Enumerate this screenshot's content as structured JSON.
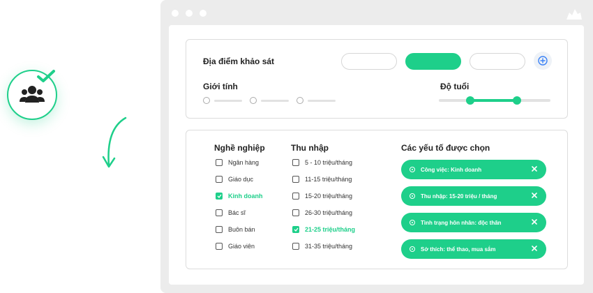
{
  "survey": {
    "location_label": "Địa điểm khảo sát",
    "gender_label": "Giới tính",
    "age_label": "Độ tuổi",
    "age_range": [
      0.28,
      0.7
    ]
  },
  "occupation": {
    "title": "Nghề nghiệp",
    "items": [
      {
        "label": "Ngân hàng",
        "checked": false
      },
      {
        "label": "Giáo dục",
        "checked": false
      },
      {
        "label": "Kinh doanh",
        "checked": true
      },
      {
        "label": "Bác sĩ",
        "checked": false
      },
      {
        "label": "Buôn bán",
        "checked": false
      },
      {
        "label": "Giáo viên",
        "checked": false
      }
    ]
  },
  "income": {
    "title": "Thu nhập",
    "items": [
      {
        "label": "5 - 10 triệu/tháng",
        "checked": false
      },
      {
        "label": "11-15 triệu/tháng",
        "checked": false
      },
      {
        "label": "15-20 triệu/tháng",
        "checked": false
      },
      {
        "label": "26-30 triệu/tháng",
        "checked": false
      },
      {
        "label": "21-25 triệu/tháng",
        "checked": true
      },
      {
        "label": "31-35 triệu/tháng",
        "checked": false
      }
    ]
  },
  "selected": {
    "title": "Các yếu tố được chọn",
    "tags": [
      "Công việc: Kinh doanh",
      "Thu nhập: 15-20 triệu / tháng",
      "Tình trạng hôn nhân: độc thân",
      "Sở thích: thể thao, mua sắm"
    ]
  },
  "colors": {
    "accent": "#1ecf8a",
    "window": "#ececec",
    "border": "#dcdcdc"
  },
  "icons": [
    "users-icon",
    "check-icon",
    "arrow-down-icon",
    "plus-circle-icon",
    "brand-logo-icon",
    "close-icon"
  ]
}
